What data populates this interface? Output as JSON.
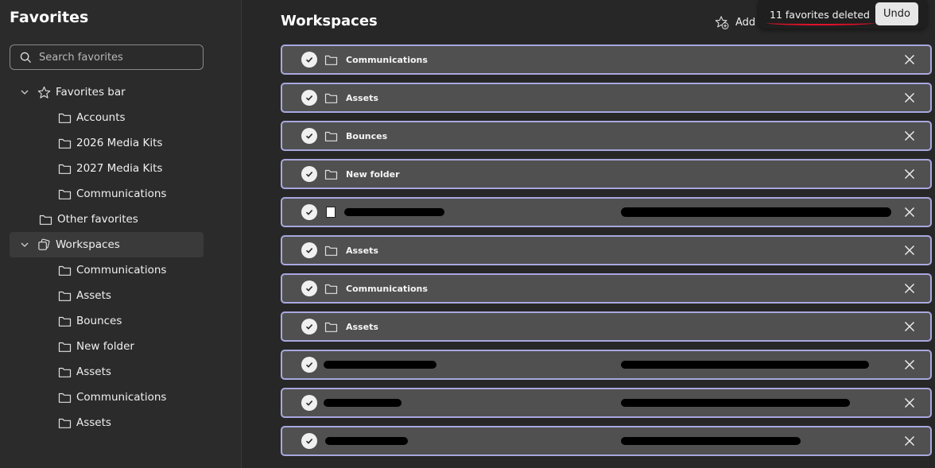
{
  "sidebar": {
    "title": "Favorites",
    "search_placeholder": "Search favorites",
    "items": [
      {
        "label": "Favorites bar"
      },
      {
        "label": "Accounts"
      },
      {
        "label": "2026 Media Kits"
      },
      {
        "label": "2027 Media Kits"
      },
      {
        "label": "Communications"
      },
      {
        "label": "Other favorites"
      },
      {
        "label": "Workspaces"
      },
      {
        "label": "Communications"
      },
      {
        "label": "Assets"
      },
      {
        "label": "Bounces"
      },
      {
        "label": "New folder"
      },
      {
        "label": "Assets"
      },
      {
        "label": "Communications"
      },
      {
        "label": "Assets"
      }
    ]
  },
  "main": {
    "title": "Workspaces",
    "add_label": "Add",
    "rows": [
      {
        "name": "Communications"
      },
      {
        "name": "Assets"
      },
      {
        "name": "Bounces"
      },
      {
        "name": "New folder"
      },
      {
        "name": ""
      },
      {
        "name": "Assets"
      },
      {
        "name": "Communications"
      },
      {
        "name": "Assets"
      },
      {
        "name": ""
      },
      {
        "name": ""
      },
      {
        "name": ""
      }
    ]
  },
  "toast": {
    "message": "11 favorites deleted",
    "undo_label": "Undo"
  },
  "colors": {
    "sidebar_bg": "#2b2b2b",
    "main_bg": "#272727",
    "row_bg": "#505050",
    "row_border": "#a8a8e0",
    "annotation_red": "#e0102a"
  }
}
